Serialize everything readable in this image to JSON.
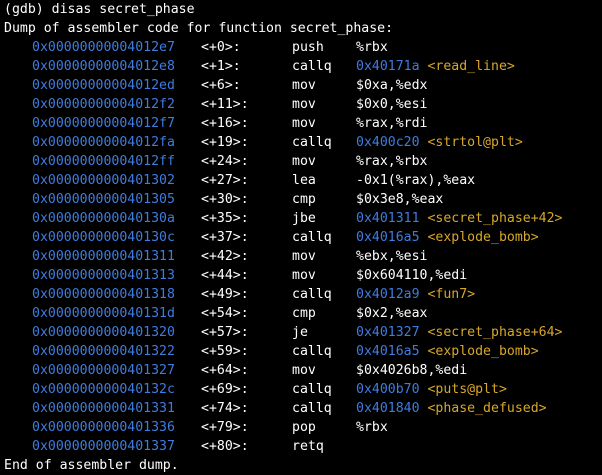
{
  "terminal": {
    "command_line": "(gdb) disas secret_phase",
    "header": "Dump of assembler code for function secret_phase:",
    "footer": "End of assembler dump.",
    "colors": {
      "background": "#000000",
      "text": "#ffffff",
      "address": "#3f7ce0",
      "symbol": "#d7a72a"
    }
  },
  "instructions": [
    {
      "address": "0x00000000004012e7",
      "offset": "<+0>:",
      "mnemonic": "push",
      "operand": "%rbx",
      "target": "",
      "symbol": ""
    },
    {
      "address": "0x00000000004012e8",
      "offset": "<+1>:",
      "mnemonic": "callq",
      "operand": "",
      "target": "0x40171a",
      "symbol": "<read_line>"
    },
    {
      "address": "0x00000000004012ed",
      "offset": "<+6>:",
      "mnemonic": "mov",
      "operand": "$0xa,%edx",
      "target": "",
      "symbol": ""
    },
    {
      "address": "0x00000000004012f2",
      "offset": "<+11>:",
      "mnemonic": "mov",
      "operand": "$0x0,%esi",
      "target": "",
      "symbol": ""
    },
    {
      "address": "0x00000000004012f7",
      "offset": "<+16>:",
      "mnemonic": "mov",
      "operand": "%rax,%rdi",
      "target": "",
      "symbol": ""
    },
    {
      "address": "0x00000000004012fa",
      "offset": "<+19>:",
      "mnemonic": "callq",
      "operand": "",
      "target": "0x400c20",
      "symbol": "<strtol@plt>"
    },
    {
      "address": "0x00000000004012ff",
      "offset": "<+24>:",
      "mnemonic": "mov",
      "operand": "%rax,%rbx",
      "target": "",
      "symbol": ""
    },
    {
      "address": "0x0000000000401302",
      "offset": "<+27>:",
      "mnemonic": "lea",
      "operand": "-0x1(%rax),%eax",
      "target": "",
      "symbol": ""
    },
    {
      "address": "0x0000000000401305",
      "offset": "<+30>:",
      "mnemonic": "cmp",
      "operand": "$0x3e8,%eax",
      "target": "",
      "symbol": ""
    },
    {
      "address": "0x000000000040130a",
      "offset": "<+35>:",
      "mnemonic": "jbe",
      "operand": "",
      "target": "0x401311",
      "symbol": "<secret_phase+42>"
    },
    {
      "address": "0x000000000040130c",
      "offset": "<+37>:",
      "mnemonic": "callq",
      "operand": "",
      "target": "0x4016a5",
      "symbol": "<explode_bomb>"
    },
    {
      "address": "0x0000000000401311",
      "offset": "<+42>:",
      "mnemonic": "mov",
      "operand": "%ebx,%esi",
      "target": "",
      "symbol": ""
    },
    {
      "address": "0x0000000000401313",
      "offset": "<+44>:",
      "mnemonic": "mov",
      "operand": "$0x604110,%edi",
      "target": "",
      "symbol": ""
    },
    {
      "address": "0x0000000000401318",
      "offset": "<+49>:",
      "mnemonic": "callq",
      "operand": "",
      "target": "0x4012a9",
      "symbol": "<fun7>"
    },
    {
      "address": "0x000000000040131d",
      "offset": "<+54>:",
      "mnemonic": "cmp",
      "operand": "$0x2,%eax",
      "target": "",
      "symbol": ""
    },
    {
      "address": "0x0000000000401320",
      "offset": "<+57>:",
      "mnemonic": "je",
      "operand": "",
      "target": "0x401327",
      "symbol": "<secret_phase+64>"
    },
    {
      "address": "0x0000000000401322",
      "offset": "<+59>:",
      "mnemonic": "callq",
      "operand": "",
      "target": "0x4016a5",
      "symbol": "<explode_bomb>"
    },
    {
      "address": "0x0000000000401327",
      "offset": "<+64>:",
      "mnemonic": "mov",
      "operand": "$0x4026b8,%edi",
      "target": "",
      "symbol": ""
    },
    {
      "address": "0x000000000040132c",
      "offset": "<+69>:",
      "mnemonic": "callq",
      "operand": "",
      "target": "0x400b70",
      "symbol": "<puts@plt>"
    },
    {
      "address": "0x0000000000401331",
      "offset": "<+74>:",
      "mnemonic": "callq",
      "operand": "",
      "target": "0x401840",
      "symbol": "<phase_defused>"
    },
    {
      "address": "0x0000000000401336",
      "offset": "<+79>:",
      "mnemonic": "pop",
      "operand": "%rbx",
      "target": "",
      "symbol": ""
    },
    {
      "address": "0x0000000000401337",
      "offset": "<+80>:",
      "mnemonic": "retq",
      "operand": "",
      "target": "",
      "symbol": ""
    }
  ]
}
